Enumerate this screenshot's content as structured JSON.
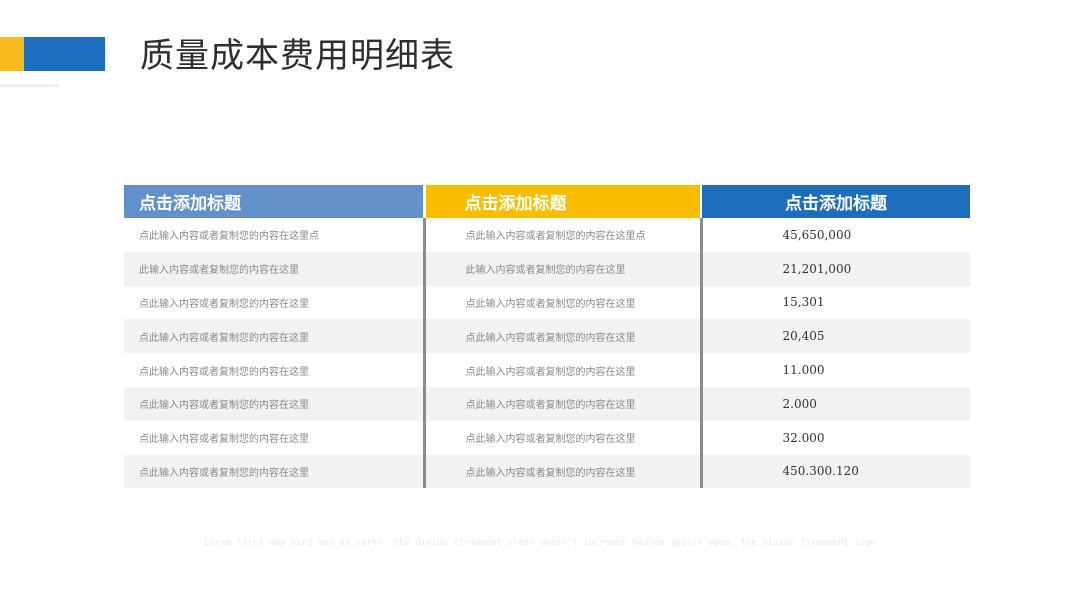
{
  "slide": {
    "title": "质量成本费用明细表",
    "accent_colors": {
      "yellow": "#f8bd1c",
      "blue": "#1c6dc0"
    }
  },
  "table": {
    "headers": [
      "点击添加标题",
      "点击添加标题",
      "点击添加标题"
    ],
    "header_colors": [
      "#6291c9",
      "#f9bd00",
      "#1c6ebd"
    ],
    "rows": [
      [
        "点此输入内容或者复制您的内容在这里点",
        "点此输入内容或者复制您的内容在这里点",
        "45,650,000"
      ],
      [
        "此输入内容或者复制您的内容在这里",
        "此输入内容或者复制您的内容在这里",
        "21,201,000"
      ],
      [
        "点此输入内容或者复制您的内容在这里",
        "点此输入内容或者复制您的内容在这里",
        "15,301"
      ],
      [
        "点此输入内容或者复制您的内容在这里",
        "点此输入内容或者复制您的内容在这里",
        "20,405"
      ],
      [
        "点此输入内容或者复制您的内容在这里",
        "点此输入内容或者复制您的内容在这里",
        "11.000"
      ],
      [
        "点此输入内容或者复制您的内容在这里",
        "点此输入内容或者复制您的内容在这里",
        "2.000"
      ],
      [
        "点此输入内容或者复制您的内容在这里",
        "点此输入内容或者复制您的内容在这里",
        "32.000"
      ],
      [
        "点此输入内容或者复制您的内容在这里",
        "点此输入内容或者复制您的内容在这里",
        "450.300.120"
      ]
    ]
  },
  "footer": {
    "text": "Lorem first-day bird and as earth, the divide firmament clear doesn't increase heaven spirit open. the divide firmament sign"
  }
}
